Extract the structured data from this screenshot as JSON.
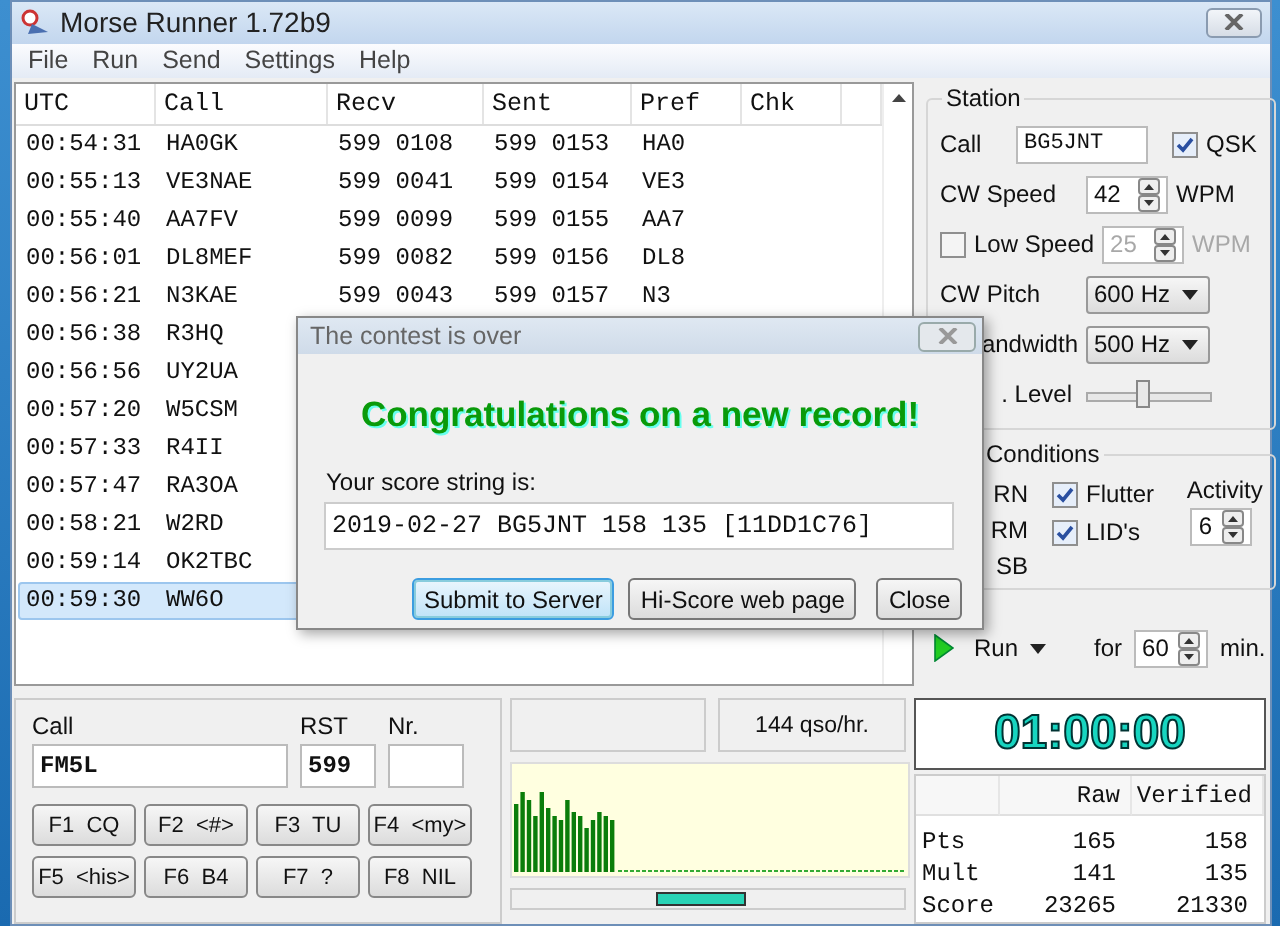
{
  "window": {
    "title": "Morse Runner 1.72b9"
  },
  "menu": [
    "File",
    "Run",
    "Send",
    "Settings",
    "Help"
  ],
  "log": {
    "columns": [
      "UTC",
      "Call",
      "Recv",
      "Sent",
      "Pref",
      "Chk"
    ],
    "rows": [
      {
        "utc": "00:54:31",
        "call": "HA0GK",
        "recv": "599 0108",
        "sent": "599 0153",
        "pref": "HA0",
        "selected": false
      },
      {
        "utc": "00:55:13",
        "call": "VE3NAE",
        "recv": "599 0041",
        "sent": "599 0154",
        "pref": "VE3",
        "selected": false
      },
      {
        "utc": "00:55:40",
        "call": "AA7FV",
        "recv": "599 0099",
        "sent": "599 0155",
        "pref": "AA7",
        "selected": false
      },
      {
        "utc": "00:56:01",
        "call": "DL8MEF",
        "recv": "599 0082",
        "sent": "599 0156",
        "pref": "DL8",
        "selected": false
      },
      {
        "utc": "00:56:21",
        "call": "N3KAE",
        "recv": "599 0043",
        "sent": "599 0157",
        "pref": "N3",
        "selected": false
      },
      {
        "utc": "00:56:38",
        "call": "R3HQ",
        "selected": false
      },
      {
        "utc": "00:56:56",
        "call": "UY2UA",
        "selected": false
      },
      {
        "utc": "00:57:20",
        "call": "W5CSM",
        "selected": false
      },
      {
        "utc": "00:57:33",
        "call": "R4II",
        "selected": false
      },
      {
        "utc": "00:57:47",
        "call": "RA3OA",
        "selected": false
      },
      {
        "utc": "00:58:21",
        "call": "W2RD",
        "selected": false
      },
      {
        "utc": "00:59:14",
        "call": "OK2TBC",
        "selected": false
      },
      {
        "utc": "00:59:30",
        "call": "WW6O",
        "selected": true
      }
    ]
  },
  "station": {
    "title": "Station",
    "call_label": "Call",
    "call": "BG5JNT",
    "qsk": {
      "label": "QSK",
      "checked": true
    },
    "cw_speed": {
      "label": "CW Speed",
      "value": "42",
      "unit": "WPM"
    },
    "low_speed": {
      "label": "Low Speed",
      "checked": false,
      "value": "25",
      "unit": "WPM"
    },
    "cw_pitch": {
      "label": "CW Pitch",
      "value": "600 Hz"
    },
    "bandwidth": {
      "label": "andwidth",
      "value": "500 Hz"
    },
    "mon_level": {
      "label": ". Level",
      "level": 0.45
    }
  },
  "conditions": {
    "title": "Conditions",
    "items": [
      {
        "label": "RN"
      },
      {
        "label": "RM"
      },
      {
        "label": "SB"
      }
    ],
    "flutter": {
      "label": "Flutter",
      "checked": true
    },
    "lids": {
      "label": "LID's",
      "checked": true
    },
    "activity": {
      "label": "Activity",
      "value": "6"
    }
  },
  "run": {
    "label": "Run",
    "for_label": "for",
    "minutes": "60",
    "unit": "min."
  },
  "entry": {
    "call_label": "Call",
    "call": "FM5L",
    "rst_label": "RST",
    "rst": "599",
    "nr_label": "Nr."
  },
  "keys": [
    "F1  CQ",
    "F2  <#>",
    "F3  TU",
    "F4  <my>",
    "F5  <his>",
    "F6  B4",
    "F7  ?",
    "F8  NIL"
  ],
  "rate": "144  qso/hr.",
  "clock": "01:00:00",
  "score": {
    "columns": [
      "Raw",
      "Verified"
    ],
    "rows": [
      {
        "label": "Pts",
        "raw": "165",
        "verified": "158"
      },
      {
        "label": "Mult",
        "raw": "141",
        "verified": "135"
      },
      {
        "label": "Score",
        "raw": "23265",
        "verified": "21330"
      }
    ]
  },
  "dialog": {
    "title": "The contest is over",
    "headline": "Congratulations on a new record!",
    "prompt": "Your score string is:",
    "score_string": "2019-02-27 BG5JNT 158 135 [11DD1C76]",
    "buttons": [
      {
        "label": "Submit to Server",
        "selected": true
      },
      {
        "label": "Hi-Score web page",
        "selected": false
      },
      {
        "label": "Close",
        "selected": false
      }
    ]
  }
}
